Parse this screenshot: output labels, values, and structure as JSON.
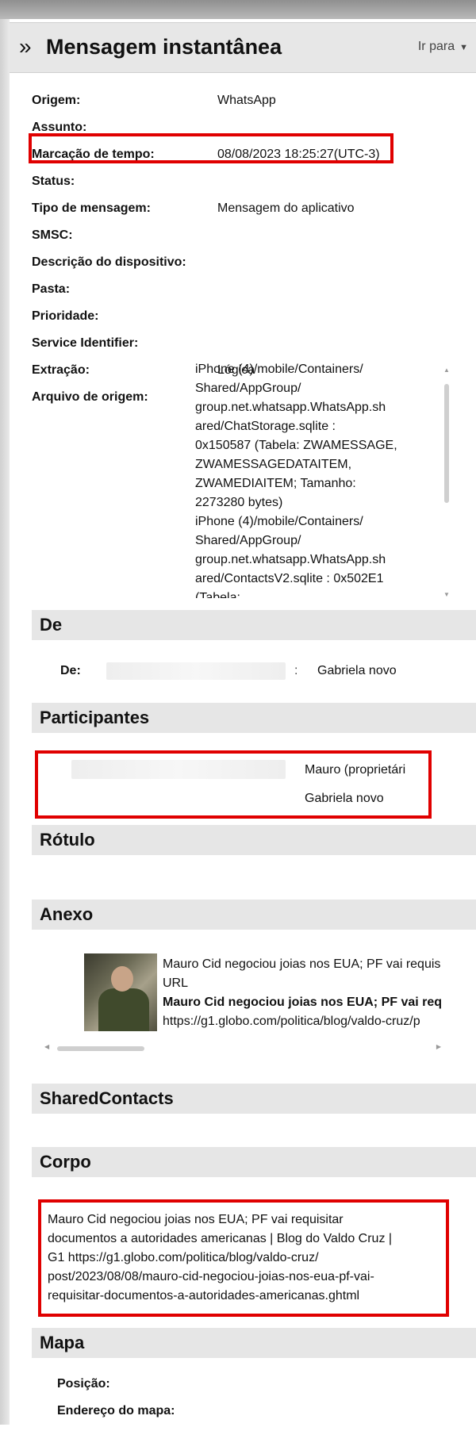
{
  "header": {
    "title": "Mensagem instantânea",
    "goto_label": "Ir para"
  },
  "properties": [
    {
      "label": "Origem:",
      "value": "WhatsApp"
    },
    {
      "label": "Assunto:",
      "value": ""
    },
    {
      "label": "Marcação de tempo:",
      "value": "08/08/2023 18:25:27(UTC-3)"
    },
    {
      "label": "Status:",
      "value": ""
    },
    {
      "label": "Tipo de mensagem:",
      "value": "Mensagem do aplicativo"
    },
    {
      "label": "SMSC:",
      "value": ""
    },
    {
      "label": "Descrição do dispositivo:",
      "value": ""
    },
    {
      "label": "Pasta:",
      "value": ""
    },
    {
      "label": "Prioridade:",
      "value": ""
    },
    {
      "label": "Service Identifier:",
      "value": ""
    },
    {
      "label": "Extração:",
      "value": "Lógica"
    },
    {
      "label": "Arquivo de origem:",
      "value": ""
    }
  ],
  "source_file_lines": [
    "iPhone (4)/mobile/Containers/",
    "Shared/AppGroup/",
    "group.net.whatsapp.WhatsApp.sh",
    "ared/ChatStorage.sqlite :",
    "0x150587 (Tabela: ZWAMESSAGE,",
    "ZWAMESSAGEDATAITEM,",
    "ZWAMEDIAITEM; Tamanho:",
    "2273280 bytes)",
    "iPhone (4)/mobile/Containers/",
    "Shared/AppGroup/",
    "group.net.whatsapp.WhatsApp.sh",
    "ared/ContactsV2.sqlite : 0x502E1",
    "(Tabela:"
  ],
  "sections": {
    "de": "De",
    "participantes": "Participantes",
    "rotulo": "Rótulo",
    "anexo": "Anexo",
    "shared_contacts": "SharedContacts",
    "corpo": "Corpo",
    "mapa": "Mapa"
  },
  "de": {
    "label": "De:",
    "separator": ":",
    "value": "Gabriela novo"
  },
  "participants": [
    {
      "name": "Mauro (proprietári"
    },
    {
      "name": "Gabriela novo"
    }
  ],
  "attachment": {
    "line1": "Mauro Cid negociou joias nos EUA; PF vai requis",
    "line2": "URL",
    "line3": "Mauro Cid negociou joias nos EUA; PF vai req",
    "line4": "https://g1.globo.com/politica/blog/valdo-cruz/p"
  },
  "body_lines": [
    "Mauro Cid negociou joias nos EUA; PF vai requisitar",
    "documentos a autoridades americanas | Blog do Valdo Cruz |",
    "G1 https://g1.globo.com/politica/blog/valdo-cruz/",
    "post/2023/08/08/mauro-cid-negociou-joias-nos-eua-pf-vai-",
    "requisitar-documentos-a-autoridades-americanas.ghtml"
  ],
  "map": {
    "position_label": "Posição:",
    "address_label": "Endereço do mapa:"
  },
  "colors": {
    "highlight_red": "#e00000",
    "section_bg": "#e6e6e6"
  }
}
